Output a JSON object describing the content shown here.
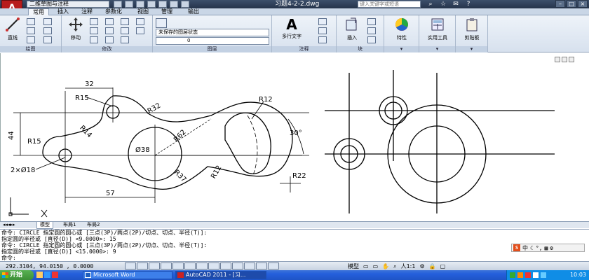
{
  "title_bar": {
    "app_logo": "A",
    "workspace": "二维草图与注释",
    "doc_title": "习题4-2-2.dwg",
    "search_placeholder": "键入关键字或短语"
  },
  "tabs": [
    "常用",
    "插入",
    "注释",
    "参数化",
    "视图",
    "管理",
    "输出"
  ],
  "ribbon": {
    "panels": [
      {
        "label": "绘图",
        "buttons": [
          "直线"
        ]
      },
      {
        "label": "修改",
        "buttons": [
          "移动"
        ]
      },
      {
        "label": "图层",
        "layer_state": "未保存的图层状态",
        "layer_name": "0"
      },
      {
        "label": "注释",
        "buttons": [
          "多行文字"
        ]
      },
      {
        "label": "块",
        "buttons": [
          "插入"
        ]
      },
      {
        "label": "",
        "buttons": [
          "特性"
        ]
      },
      {
        "label": "",
        "buttons": [
          "实用工具"
        ]
      },
      {
        "label": "",
        "buttons": [
          "剪贴板"
        ]
      }
    ]
  },
  "drawing": {
    "dims": {
      "d32": "32",
      "r15_top": "R15",
      "r32": "R32",
      "r12": "R12",
      "d44": "44",
      "r14": "R14",
      "r62": "R62",
      "ang30": "30°",
      "r15_left": "R15",
      "dia38": "Ø38",
      "r37": "R37",
      "r12_bottom": "R12",
      "two_dia18": "2×Ø18",
      "r22": "R22",
      "d57": "57"
    }
  },
  "layout_tabs": [
    "模型",
    "布局1",
    "布局2"
  ],
  "command": {
    "lines": [
      "命令:  CIRCLE 指定圆的圆心或 [三点(3P)/两点(2P)/切点、切点、半径(T)]:",
      "指定圆的半径或 [直径(D)] <9.0000>: 15",
      "命令:  CIRCLE 指定圆的圆心或 [三点(3P)/两点(2P)/切点、切点、半径(T)]:",
      "指定圆的半径或 [直径(D)] <15.0000>: 9",
      "命令:"
    ],
    "ime": "中"
  },
  "status": {
    "coords": "292.3104, 94.0150 , 0.0000",
    "model_label": "模型",
    "scale": "人1:1"
  },
  "taskbar": {
    "start": "开始",
    "tasks": [
      "Microsoft Word",
      "AutoCAD 2011 - [习..."
    ],
    "clock": "10:03"
  },
  "colors": {
    "titlebar": "#25344b",
    "logo_red": "#b81c1c",
    "taskbar_blue": "#245edb",
    "start_green": "#3c8f36"
  }
}
